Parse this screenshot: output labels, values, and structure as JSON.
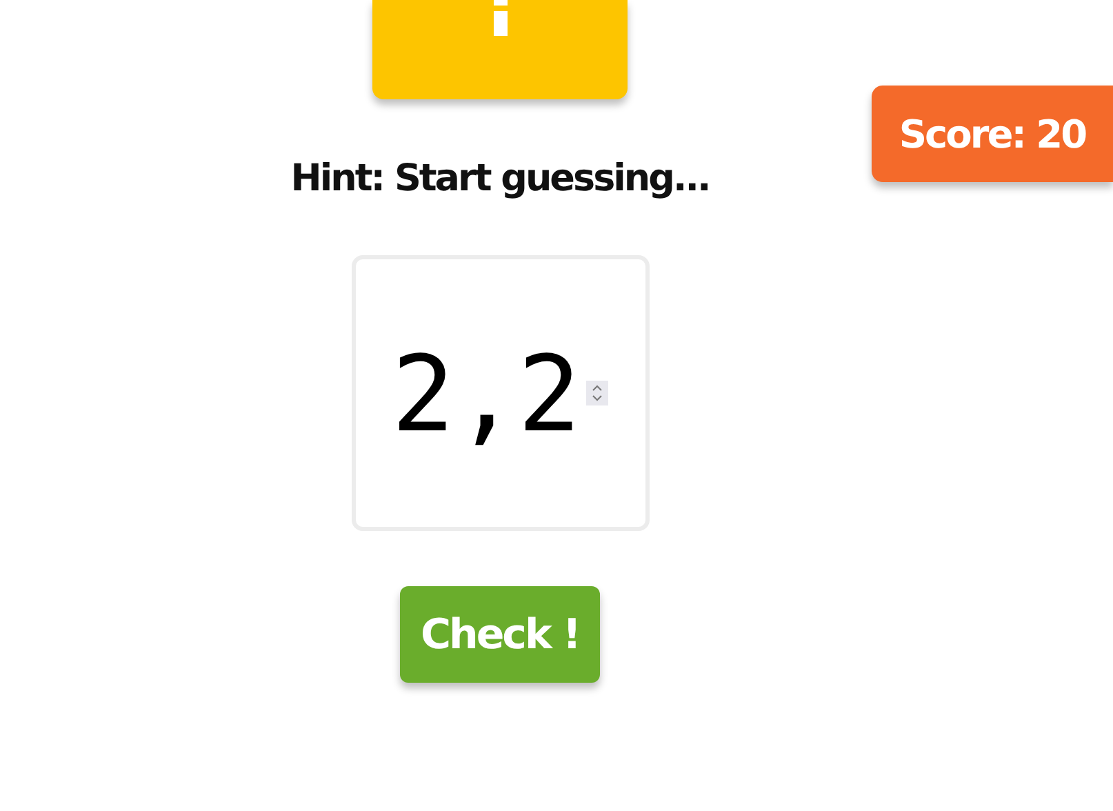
{
  "hint": "Hint: Start guessing...",
  "guess": {
    "value": "2,2"
  },
  "check_button": "Check !",
  "score": "Score: 20"
}
